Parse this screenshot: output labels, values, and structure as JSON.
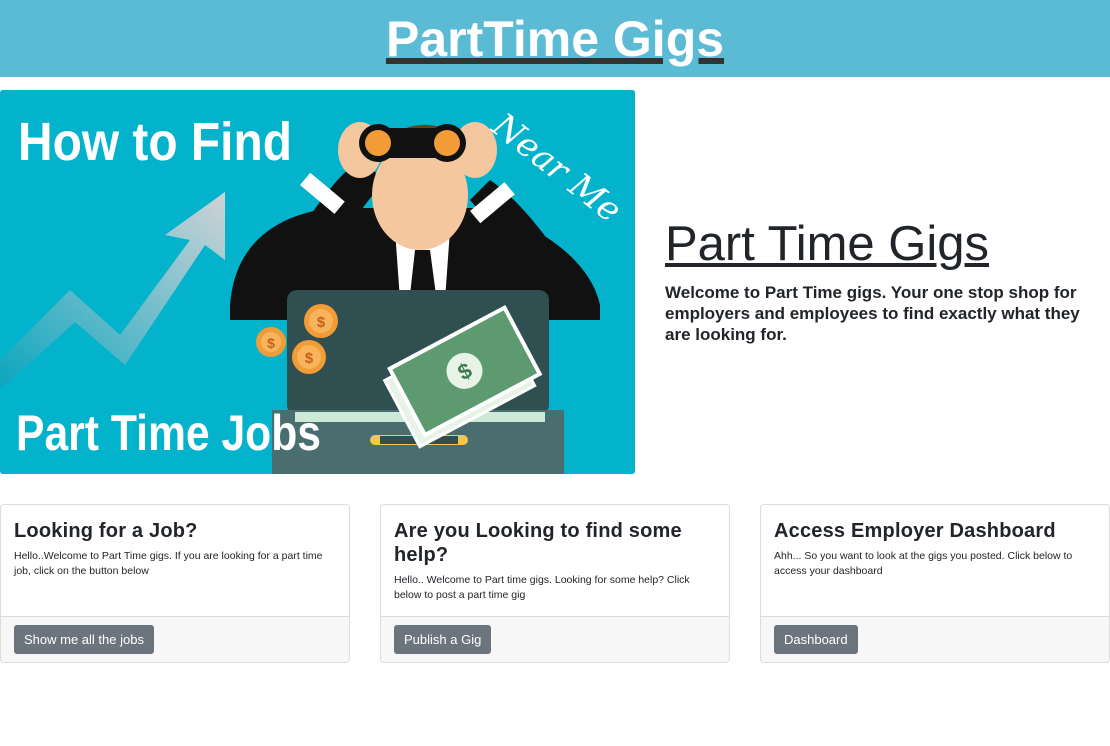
{
  "header": {
    "brand": "PartTime Gigs"
  },
  "hero": {
    "image": {
      "headline_top": "How to Find",
      "script_text": "Near Me",
      "headline_bottom": "Part Time Jobs",
      "coin_symbol": "$",
      "bill_symbol": "$"
    },
    "title": "Part Time Gigs",
    "description": "Welcome to Part Time gigs. Your one stop shop for employers and employees to find exactly what they are looking for."
  },
  "cards": [
    {
      "title": "Looking for a Job?",
      "text": "Hello..Welcome to Part Time gigs. If you are looking for a part time job, click on the button below",
      "button": "Show me all the jobs"
    },
    {
      "title": "Are you Looking to find some help?",
      "text": "Hello.. Welcome to Part time gigs. Looking for some help? Click below to post a part time gig",
      "button": "Publish a Gig"
    },
    {
      "title": "Access Employer Dashboard",
      "text": "Ahh... So you want to look at the gigs you posted. Click below to access your dashboard",
      "button": "Dashboard"
    }
  ],
  "colors": {
    "header_bg": "#5bbad4",
    "hero_bg": "#03b3cc",
    "button_bg": "#6c757d",
    "card_footer_bg": "#f7f7f7"
  }
}
